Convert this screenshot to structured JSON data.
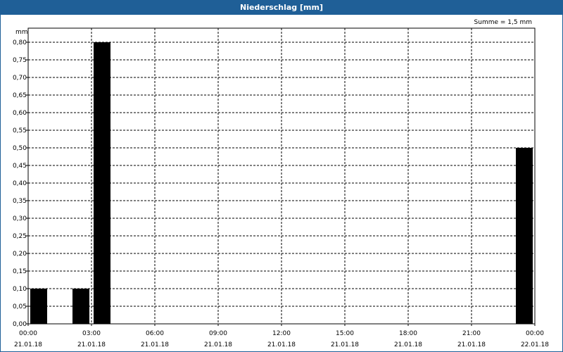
{
  "window": {
    "title": "Niederschlag [mm]"
  },
  "chart_data": {
    "type": "bar",
    "title": "Niederschlag [mm]",
    "ylabel": "mm",
    "annotation": "Summe = 1,5 mm",
    "ylim": [
      0,
      0.8
    ],
    "ytick_labels": [
      "0,00",
      "0,05",
      "0,10",
      "0,15",
      "0,20",
      "0,25",
      "0,30",
      "0,35",
      "0,40",
      "0,45",
      "0,50",
      "0,55",
      "0,60",
      "0,65",
      "0,70",
      "0,75",
      "0,80"
    ],
    "xlim_hours": [
      0,
      24
    ],
    "xticks": [
      {
        "hours": 0,
        "time": "00:00",
        "date": "21.01.18"
      },
      {
        "hours": 3,
        "time": "03:00",
        "date": "21.01.18"
      },
      {
        "hours": 6,
        "time": "06:00",
        "date": "21.01.18"
      },
      {
        "hours": 9,
        "time": "09:00",
        "date": "21.01.18"
      },
      {
        "hours": 12,
        "time": "12:00",
        "date": "21.01.18"
      },
      {
        "hours": 15,
        "time": "15:00",
        "date": "21.01.18"
      },
      {
        "hours": 18,
        "time": "18:00",
        "date": "21.01.18"
      },
      {
        "hours": 21,
        "time": "21:00",
        "date": "21.01.18"
      },
      {
        "hours": 24,
        "time": "00:00",
        "date": "22.01.18"
      }
    ],
    "bars": [
      {
        "start_hours": 0.0,
        "end_hours": 1.0,
        "value": 0.1
      },
      {
        "start_hours": 2.0,
        "end_hours": 3.0,
        "value": 0.1
      },
      {
        "start_hours": 3.0,
        "end_hours": 4.0,
        "value": 0.8
      },
      {
        "start_hours": 23.0,
        "end_hours": 24.0,
        "value": 0.5
      }
    ],
    "grid": true,
    "bar_color": "#000000",
    "grid_color": "#000000",
    "title_bar_color": "#1f5f97"
  }
}
